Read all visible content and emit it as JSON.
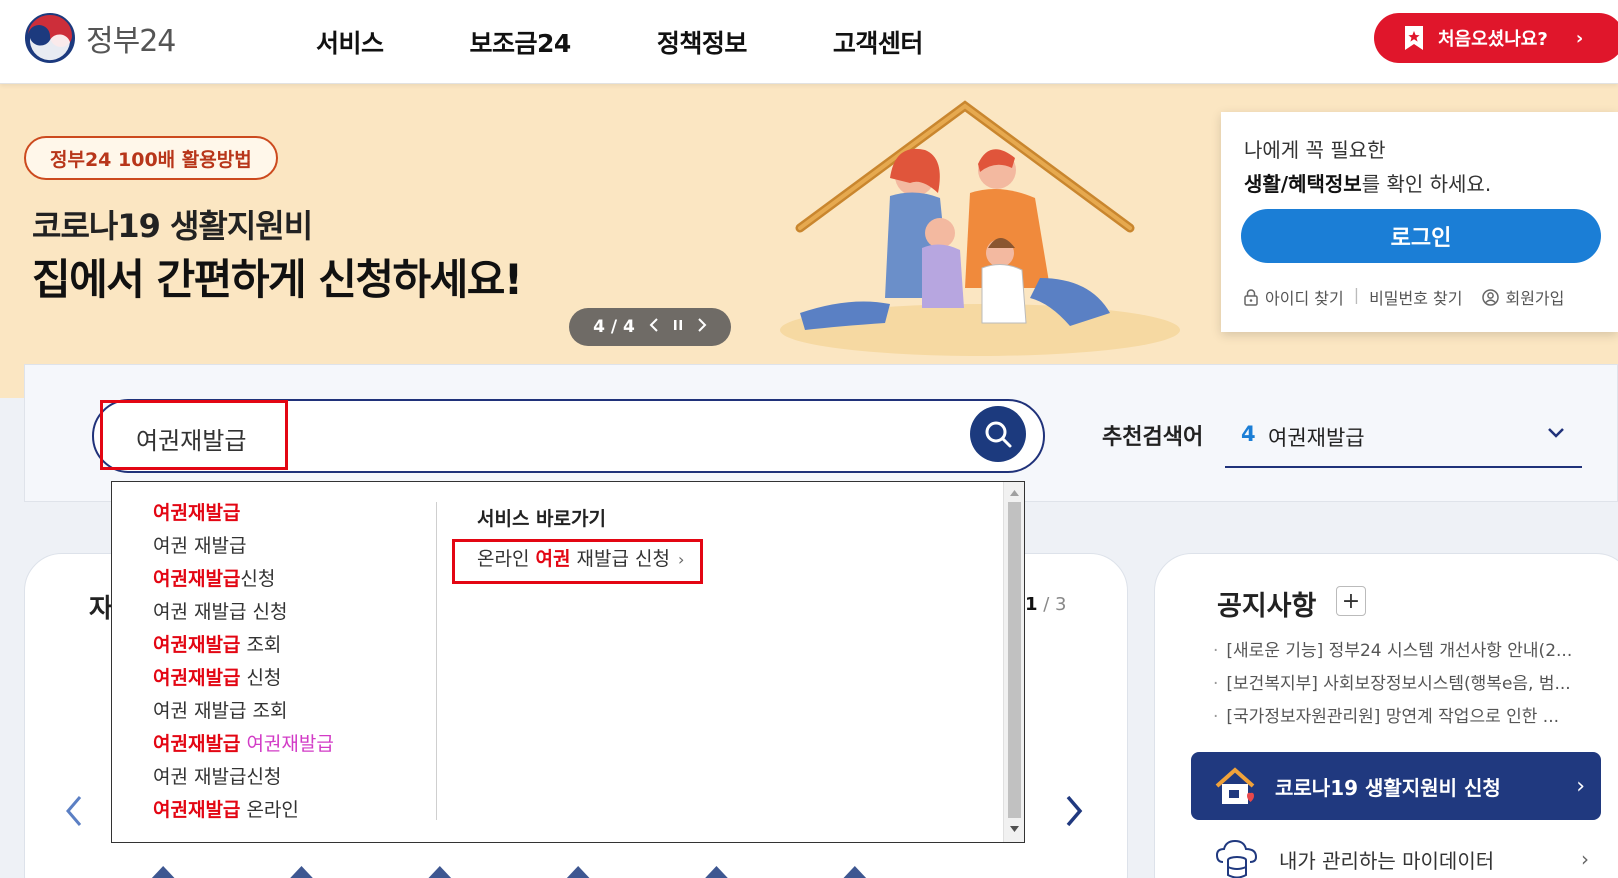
{
  "header": {
    "logo_text": "정부24",
    "nav": [
      "서비스",
      "보조금24",
      "정책정보",
      "고객센터"
    ],
    "first_visit_label": "처음오셨나요?",
    "first_visit_arrow": "›"
  },
  "banner": {
    "pill_label": "정부24 100배 활용방법",
    "subtitle": "코로나19 생활지원비",
    "title": "집에서 간편하게 신청하세요!",
    "slider_count": "4 / 4"
  },
  "login": {
    "line1": "나에게 꼭 필요한",
    "line2_bold": "생활/혜택정보",
    "line2_rest": "를 확인 하세요.",
    "button_label": "로그인",
    "links": [
      "아이디 찾기",
      "비밀번호 찾기",
      "회원가입"
    ],
    "separator": "|"
  },
  "search": {
    "value": "여권재발급",
    "recommended_label": "추천검색어",
    "recommended_number": "4",
    "recommended_value": "여권재발급"
  },
  "autocomplete": {
    "items": [
      {
        "kw": "여권재발급",
        "rest": "",
        "extra": ""
      },
      {
        "kw": "",
        "rest": "여권 재발급",
        "extra": ""
      },
      {
        "kw": "여권재발급",
        "rest": "신청",
        "extra": ""
      },
      {
        "kw": "",
        "rest": "여권 재발급 신청",
        "extra": ""
      },
      {
        "kw": "여권재발급",
        "rest": " 조회",
        "extra": ""
      },
      {
        "kw": "여권재발급",
        "rest": " 신청",
        "extra": ""
      },
      {
        "kw": "",
        "rest": "여권 재발급 조회",
        "extra": ""
      },
      {
        "kw": "여권재발급",
        "rest": " ",
        "extra": "여권재발급"
      },
      {
        "kw": "",
        "rest": "여권 재발급신청",
        "extra": ""
      },
      {
        "kw": "여권재발급",
        "rest": " 온라인",
        "extra": ""
      }
    ],
    "shortcut_title": "서비스 바로가기",
    "service_prefix": "온라인 ",
    "service_kw": "여권",
    "service_suffix": " 재발급 신청",
    "service_chevron": "›"
  },
  "card_left": {
    "title_partial": "자",
    "pager_current": "1",
    "pager_total": " / 3"
  },
  "notice": {
    "title": "공지사항",
    "plus": "+",
    "items": [
      "[새로운 기능] 정부24 시스템 개선사항 안내(2...",
      "[보건복지부] 사회보장정보시스템(행복e음, 범...",
      "[국가정보자원관리원] 망연계 작업으로 인한 ..."
    ],
    "covid_button": "코로나19 생활지원비 신청",
    "mydata_label": "내가 관리하는 마이데이터",
    "arrow": "›"
  },
  "colors": {
    "brand_navy": "#20327a",
    "accent_red": "#e30613",
    "login_blue": "#1b7ed6",
    "banner_bg": "#fbe6c2"
  }
}
